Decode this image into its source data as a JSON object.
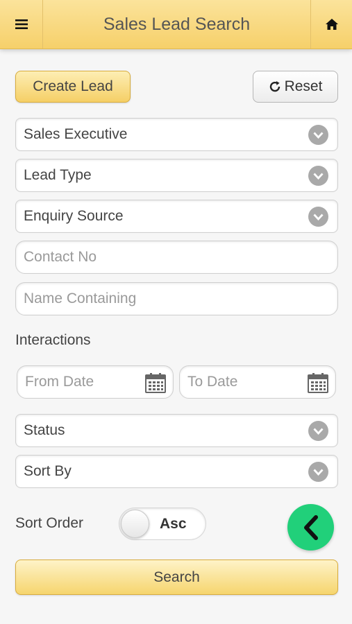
{
  "header": {
    "title": "Sales Lead Search",
    "menu_icon": "hamburger-menu-icon",
    "home_icon": "home-icon"
  },
  "actions": {
    "create_label": "Create Lead",
    "reset_label": "Reset",
    "reset_icon": "refresh-icon"
  },
  "filters": {
    "sales_executive": "Sales Executive",
    "lead_type": "Lead Type",
    "enquiry_source": "Enquiry Source",
    "contact_placeholder": "Contact No",
    "name_placeholder": "Name Containing"
  },
  "interactions": {
    "label": "Interactions",
    "from_placeholder": "From Date",
    "to_placeholder": "To Date"
  },
  "status": "Status",
  "sort_by": "Sort By",
  "sort_order": {
    "label": "Sort Order",
    "value": "Asc"
  },
  "search_label": "Search",
  "colors": {
    "header_bg": "#f6d06a",
    "button_yellow": "#f5cf66",
    "fab_green": "#21d07a"
  }
}
